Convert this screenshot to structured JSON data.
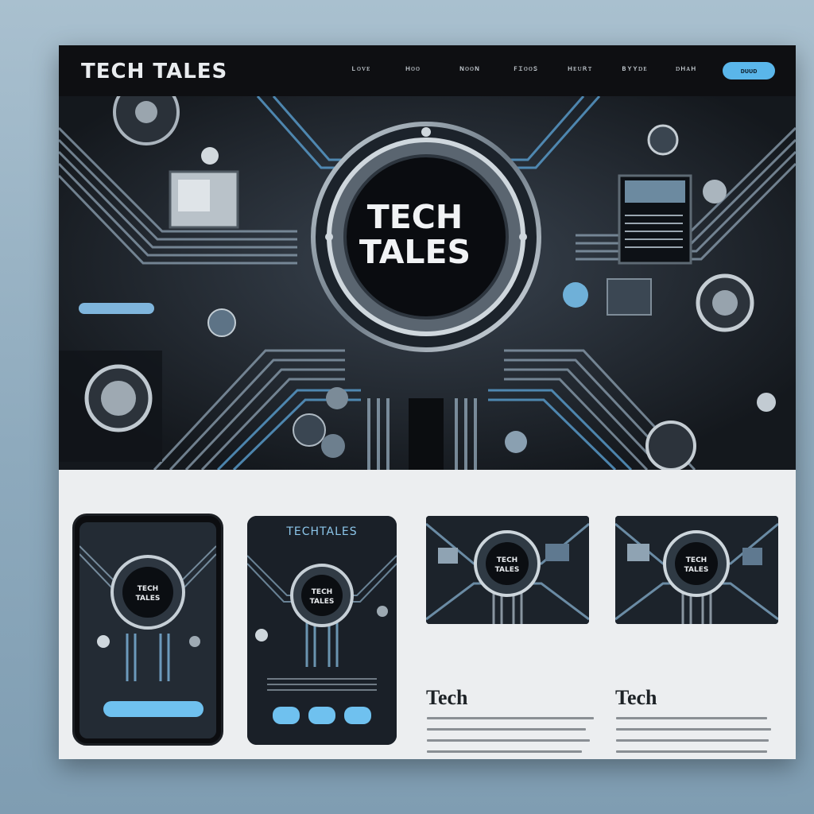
{
  "header": {
    "brand": "TECH TALES",
    "nav": [
      "ʟᴏᴠᴇ",
      "ʜᴏᴏ",
      "ɴᴏᴏɴ",
      "ꜰɪᴏᴏꜱ",
      "ʜᴇᴜʀᴛ",
      "ʙʏʏᴅᴇ",
      "ᴅʜᴀʜ"
    ],
    "cta_label": "ᴅᴜᴜᴅ"
  },
  "hero": {
    "title_line1": "TECH",
    "title_line2": "TALES"
  },
  "devices": {
    "tablet_brand": "TECHTALES"
  },
  "cards": [
    {
      "title": "Tech"
    },
    {
      "title": "Tech"
    }
  ],
  "colors": {
    "accent": "#5ab6ea",
    "dark": "#0e0f12",
    "hero_bg": "#1a1e24"
  }
}
